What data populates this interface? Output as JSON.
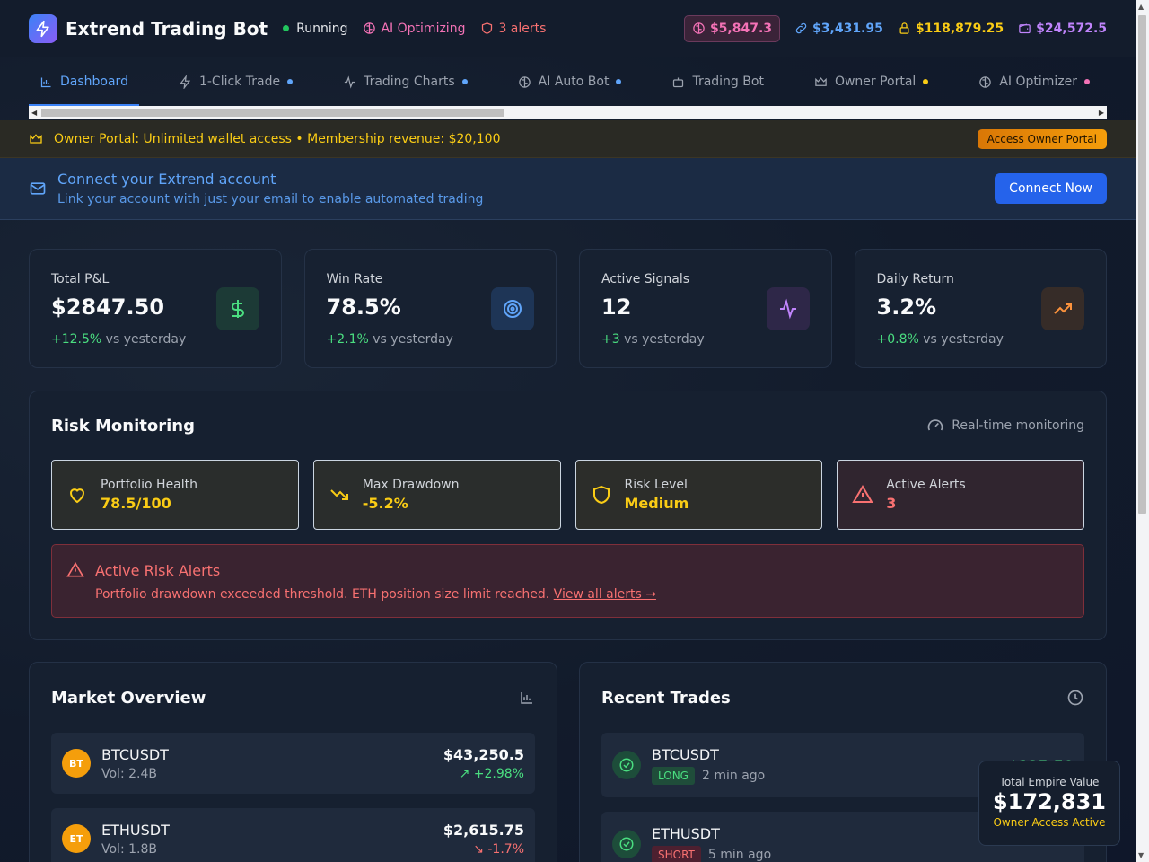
{
  "header": {
    "app_title": "Extrend Trading Bot",
    "status": "Running",
    "ai_status": "AI Optimizing",
    "alerts": "3 alerts",
    "balances": [
      "$5,847.3",
      "$3,431.95",
      "$118,879.25",
      "$24,572.5"
    ]
  },
  "tabs": [
    {
      "label": "Dashboard",
      "active": true,
      "dot": ""
    },
    {
      "label": "1-Click Trade",
      "dot": "#60a5fa"
    },
    {
      "label": "Trading Charts",
      "dot": "#60a5fa"
    },
    {
      "label": "AI Auto Bot",
      "dot": "#60a5fa"
    },
    {
      "label": "Trading Bot",
      "dot": ""
    },
    {
      "label": "Owner Portal",
      "dot": "#facc15"
    },
    {
      "label": "AI Optimizer",
      "dot": "#f472b6"
    }
  ],
  "owner_banner": {
    "text": "Owner Portal: Unlimited wallet access • Membership revenue: $20,100",
    "button": "Access Owner Portal"
  },
  "connect": {
    "title": "Connect your Extrend account",
    "subtitle": "Link your account with just your email to enable automated trading",
    "button": "Connect Now"
  },
  "stats": [
    {
      "label": "Total P&L",
      "value": "$2847.50",
      "delta": "+12.5%",
      "suffix": " vs yesterday"
    },
    {
      "label": "Win Rate",
      "value": "78.5%",
      "delta": "+2.1%",
      "suffix": " vs yesterday"
    },
    {
      "label": "Active Signals",
      "value": "12",
      "delta": "+3",
      "suffix": " vs yesterday"
    },
    {
      "label": "Daily Return",
      "value": "3.2%",
      "delta": "+0.8%",
      "suffix": " vs yesterday"
    }
  ],
  "risk": {
    "title": "Risk Monitoring",
    "realtime": "Real-time monitoring",
    "cards": [
      {
        "label": "Portfolio Health",
        "value": "78.5/100"
      },
      {
        "label": "Max Drawdown",
        "value": "-5.2%"
      },
      {
        "label": "Risk Level",
        "value": "Medium"
      },
      {
        "label": "Active Alerts",
        "value": "3"
      }
    ],
    "alert_title": "Active Risk Alerts",
    "alert_text": "Portfolio drawdown exceeded threshold. ETH position size limit reached. ",
    "alert_link": "View all alerts →"
  },
  "market": {
    "title": "Market Overview",
    "rows": [
      {
        "coin": "BT",
        "symbol": "BTCUSDT",
        "volume": "Vol: 2.4B",
        "price": "$43,250.5",
        "change": "+2.98%"
      },
      {
        "coin": "ET",
        "symbol": "ETHUSDT",
        "volume": "Vol: 1.8B",
        "price": "$2,615.75",
        "change": "-1.7%"
      }
    ]
  },
  "trades": {
    "title": "Recent Trades",
    "rows": [
      {
        "symbol": "BTCUSDT",
        "side": "LONG",
        "time": "2 min ago",
        "pnl": "+$125.50"
      },
      {
        "symbol": "ETHUSDT",
        "side": "SHORT",
        "time": "5 min ago",
        "pnl": ""
      }
    ]
  },
  "empire": {
    "label": "Total Empire Value",
    "value": "$172,831",
    "status": "Owner Access Active"
  }
}
